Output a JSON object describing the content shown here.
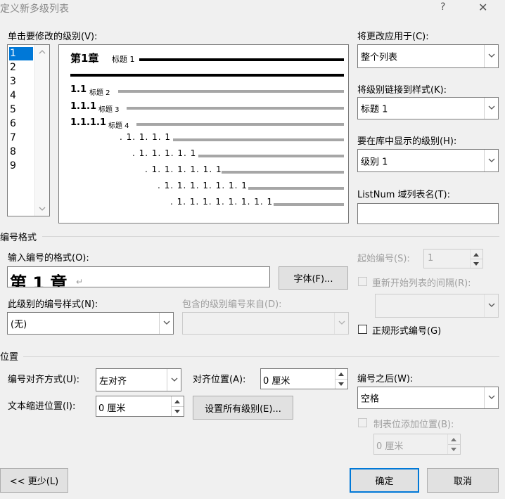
{
  "window": {
    "title": "定义新多级列表",
    "help_glyph": "?",
    "close_glyph": "✕"
  },
  "level_list": {
    "label": "单击要修改的级别(V):",
    "items": [
      "1",
      "2",
      "3",
      "4",
      "5",
      "6",
      "7",
      "8",
      "9"
    ],
    "selected": "1"
  },
  "preview": {
    "line1_number": "第1章",
    "line1_style": "标题 1",
    "rows": [
      {
        "number": "1.1",
        "style": "标题 2"
      },
      {
        "number": "1.1.1",
        "style": "标题 3"
      },
      {
        "number": "1.1.1.1",
        "style": "标题 4"
      },
      {
        "number": ". 1. 1. 1. 1"
      },
      {
        "number": ". 1. 1. 1. 1. 1"
      },
      {
        "number": ". 1. 1. 1. 1. 1. 1"
      },
      {
        "number": ". 1. 1. 1. 1. 1. 1. 1"
      },
      {
        "number": ". 1. 1. 1. 1. 1. 1. 1. 1"
      }
    ]
  },
  "right_panel": {
    "apply_label": "将更改应用于(C):",
    "apply_value": "整个列表",
    "link_label": "将级别链接到样式(K):",
    "link_value": "标题 1",
    "gallery_label": "要在库中显示的级别(H):",
    "gallery_value": "级别 1",
    "listnum_label": "ListNum 域列表名(T):",
    "listnum_value": ""
  },
  "number_format": {
    "section_title": "编号格式",
    "format_label": "输入编号的格式(O):",
    "format_value": "第 1 章",
    "font_button": "字体(F)...",
    "style_label": "此级别的编号样式(N):",
    "style_value": "(无)",
    "include_label": "包含的级别编号来自(D):",
    "include_value": "",
    "start_label": "起始编号(S):",
    "start_value": "1",
    "restart_label": "重新开始列表的间隔(R):",
    "restart_value": "",
    "legal_label": "正规形式编号(G)"
  },
  "position": {
    "section_title": "位置",
    "align_label": "编号对齐方式(U):",
    "align_value": "左对齐",
    "align_at_label": "对齐位置(A):",
    "align_at_value": "0 厘米",
    "indent_label": "文本缩进位置(I):",
    "indent_value": "0 厘米",
    "set_all_button": "设置所有级别(E)...",
    "follow_label": "编号之后(W):",
    "follow_value": "空格",
    "tab_label": "制表位添加位置(B):",
    "tab_value": "0 厘米"
  },
  "footer": {
    "less_button": "<< 更少(L)",
    "ok_button": "确定",
    "cancel_button": "取消"
  }
}
